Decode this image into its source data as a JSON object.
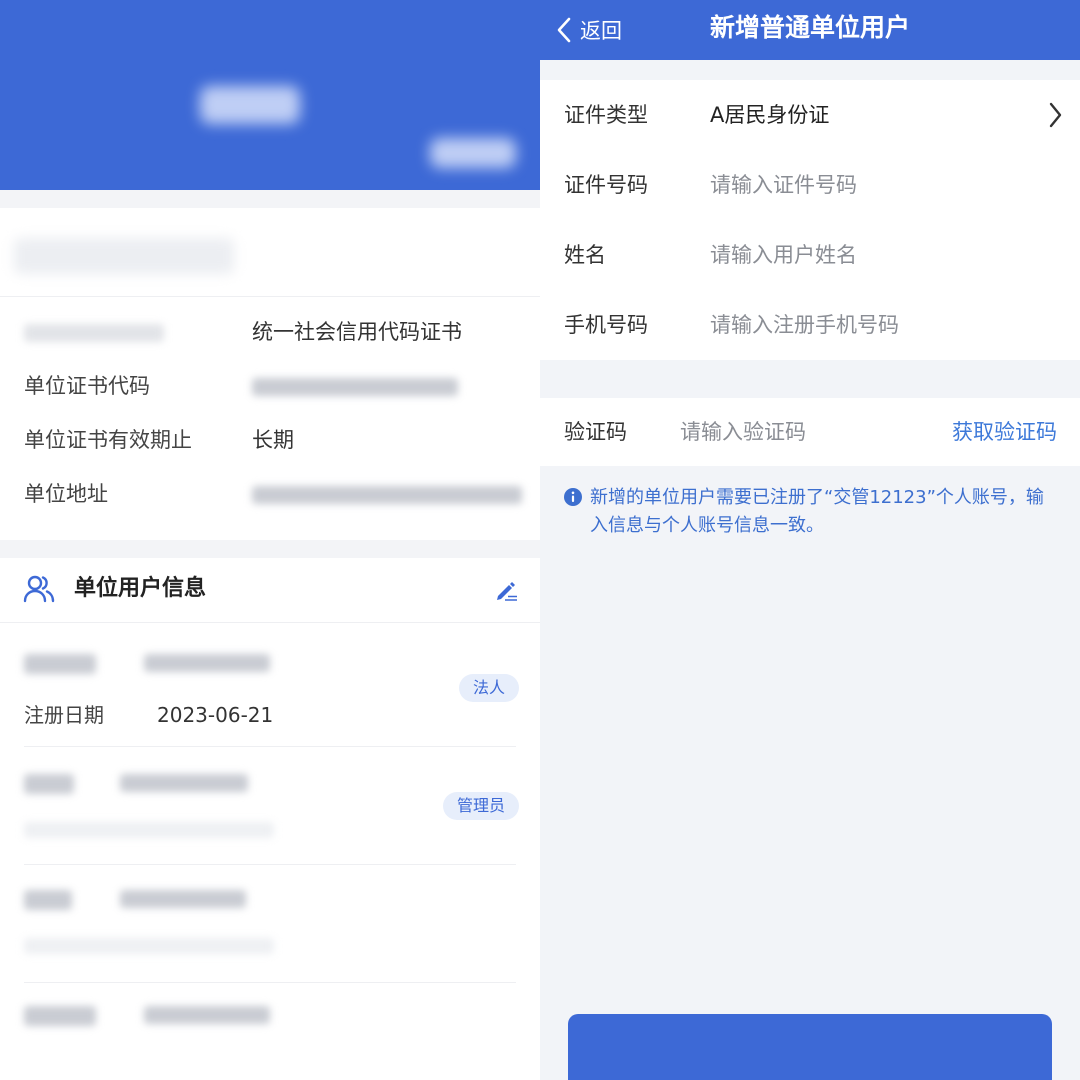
{
  "left": {
    "cert_type_value": "统一社会信用代码证书",
    "rows": [
      {
        "label": "单位证书代码"
      },
      {
        "label": "单位证书有效期止",
        "value": "长期"
      },
      {
        "label": "单位地址"
      }
    ],
    "section_title": "单位用户信息",
    "users": [
      {
        "tag": "法人",
        "reg_label": "注册日期",
        "reg_date": "2023-06-21"
      },
      {
        "tag": "管理员"
      }
    ]
  },
  "right": {
    "back_label": "返回",
    "title": "新增普通单位用户",
    "form": {
      "cert_type_label": "证件类型",
      "cert_type_value": "A居民身份证",
      "cert_no_label": "证件号码",
      "cert_no_placeholder": "请输入证件号码",
      "name_label": "姓名",
      "name_placeholder": "请输入用户姓名",
      "phone_label": "手机号码",
      "phone_placeholder": "请输入注册手机号码"
    },
    "verify": {
      "label": "验证码",
      "placeholder": "请输入验证码",
      "get_code": "获取验证码"
    },
    "notice": "新增的单位用户需要已注册了“交管12123”个人账号，输入信息与个人账号信息一致。"
  },
  "colors": {
    "primary": "#3d69d6",
    "link": "#3d79d9",
    "tag_bg": "#e7eefb",
    "page_bg": "#f2f4f8"
  },
  "icons": [
    "users-icon",
    "edit-icon",
    "chevron-left-icon",
    "chevron-right-icon",
    "info-icon"
  ]
}
